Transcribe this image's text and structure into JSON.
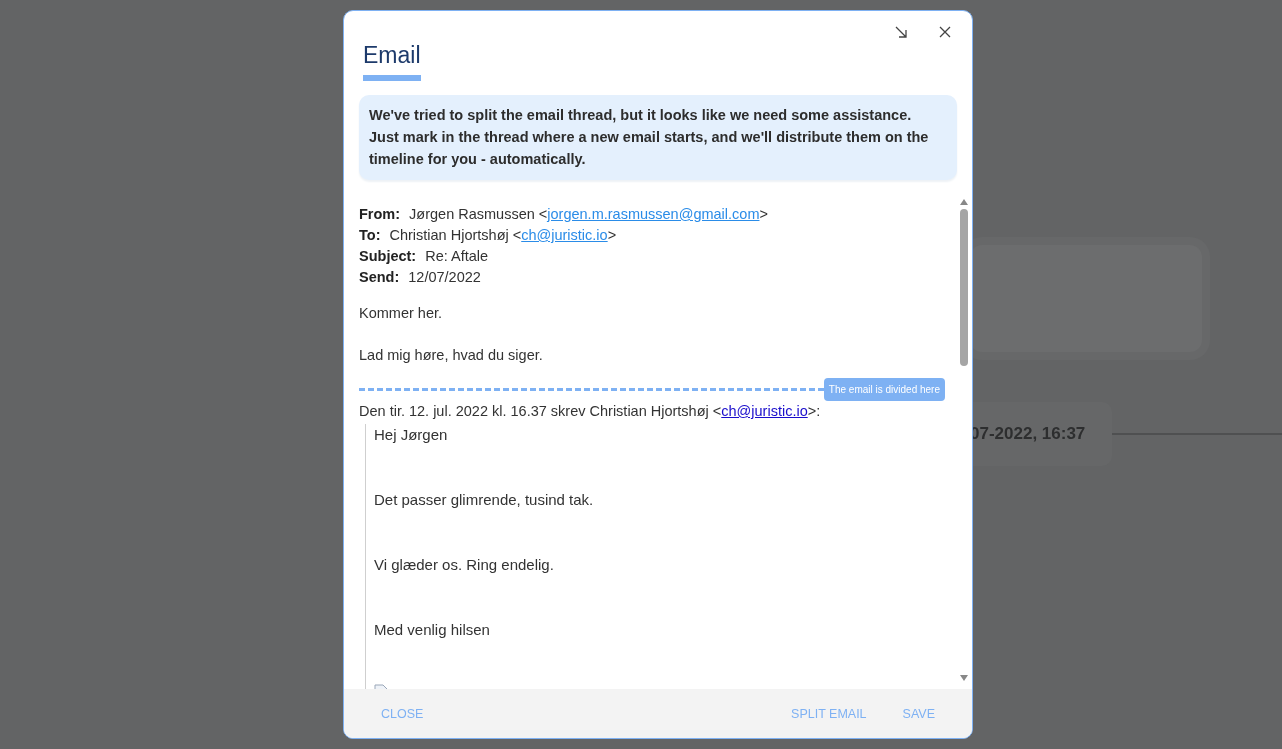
{
  "background": {
    "timestamp": "07-2022, 16:37"
  },
  "dialog": {
    "title": "Email",
    "notice": "We've tried to split the email thread, but it looks like we need some assistance. Just mark in the thread where a new email starts, and we'll distribute them on the timeline for you - automatically.",
    "header_fields": [
      {
        "label": "From:",
        "before": "Jørgen Rasmussen <",
        "email": "jorgen.m.rasmussen@gmail.com",
        "after": ">"
      },
      {
        "label": "To:",
        "before": "Christian Hjortshøj <",
        "email": "ch@juristic.io",
        "after": ">"
      },
      {
        "label": "Subject:",
        "before": "Re: Aftale"
      },
      {
        "label": "Send:",
        "before": "12/07/2022"
      }
    ],
    "body": [
      "Kommer her.",
      "Lad mig høre, hvad du siger."
    ],
    "divider": {
      "label": "The email is divided here"
    },
    "quote_intro": {
      "before": "Den tir. 12. jul. 2022 kl. 16.37 skrev Christian Hjortshøj <",
      "email": "ch@juristic.io",
      "after": ">:"
    },
    "quoted": [
      "Hej Jørgen",
      "Det passer glimrende, tusind tak.",
      "Vi glæder os. Ring endelig.",
      "Med venlig hilsen"
    ],
    "buttons_left": [
      "CLOSE"
    ],
    "buttons_right": [
      "SPLIT EMAIL",
      "SAVE"
    ]
  }
}
